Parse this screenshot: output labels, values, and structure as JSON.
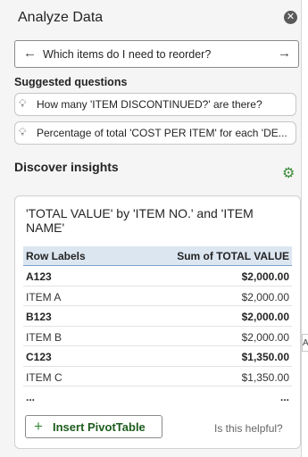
{
  "pane": {
    "title": "Analyze Data",
    "close_icon": "close-icon"
  },
  "query": {
    "back_icon": "arrow-left-icon",
    "text": "Which items do I need to reorder?",
    "submit_icon": "arrow-right-icon"
  },
  "suggested": {
    "label": "Suggested questions",
    "items": [
      {
        "icon": "lightbulb-icon",
        "text": "How many 'ITEM DISCONTINUED?' are there?"
      },
      {
        "icon": "lightbulb-icon",
        "text": "Percentage of total 'COST PER ITEM' for each 'DE..."
      }
    ]
  },
  "insights": {
    "label": "Discover insights",
    "settings_icon": "gear-icon",
    "card": {
      "title": "'TOTAL VALUE' by 'ITEM NO.' and 'ITEM NAME'",
      "columns": [
        "Row Labels",
        "Sum of TOTAL VALUE"
      ],
      "rows": [
        {
          "label": "A123",
          "value": "$2,000.00",
          "bold": true
        },
        {
          "label": "ITEM A",
          "value": "$2,000.00",
          "bold": false
        },
        {
          "label": "B123",
          "value": "$2,000.00",
          "bold": true
        },
        {
          "label": "ITEM B",
          "value": "$2,000.00",
          "bold": false
        },
        {
          "label": "C123",
          "value": "$1,350.00",
          "bold": true
        },
        {
          "label": "ITEM C",
          "value": "$1,350.00",
          "bold": false
        }
      ],
      "ellipsis_left": "...",
      "ellipsis_right": "...",
      "insert_button": "Insert PivotTable",
      "helpful_text": "Is this helpful?"
    }
  },
  "edge_tag": "A",
  "colors": {
    "accent_green": "#3a8a3a",
    "header_blue": "#dce6f1",
    "pane_bg": "#f5f5f5"
  }
}
